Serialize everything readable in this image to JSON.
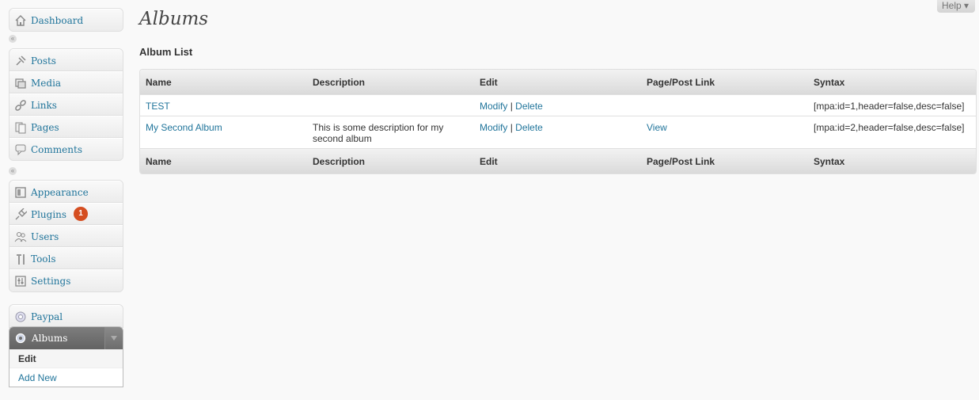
{
  "menu": {
    "group1": [
      {
        "label": "Dashboard",
        "icon": "dashboard-icon"
      }
    ],
    "group2": [
      {
        "label": "Posts",
        "icon": "posts-pin-icon"
      },
      {
        "label": "Media",
        "icon": "media-icon"
      },
      {
        "label": "Links",
        "icon": "links-icon"
      },
      {
        "label": "Pages",
        "icon": "pages-icon"
      },
      {
        "label": "Comments",
        "icon": "comments-icon"
      }
    ],
    "group3": [
      {
        "label": "Appearance",
        "icon": "appearance-icon"
      },
      {
        "label": "Plugins",
        "icon": "plugins-icon",
        "badge": "1"
      },
      {
        "label": "Users",
        "icon": "users-icon"
      },
      {
        "label": "Tools",
        "icon": "tools-icon"
      },
      {
        "label": "Settings",
        "icon": "settings-icon"
      }
    ],
    "group4": [
      {
        "label": "Paypal",
        "icon": "paypal-icon"
      }
    ],
    "albums": {
      "label": "Albums",
      "icon": "albums-gear-icon",
      "submenu": [
        {
          "label": "Edit",
          "current": true
        },
        {
          "label": "Add New",
          "current": false
        }
      ]
    },
    "collapse_symbol": "«"
  },
  "help": {
    "label": "Help ▾"
  },
  "page": {
    "title": "Albums",
    "subtitle": "Album List"
  },
  "table": {
    "columns": [
      "Name",
      "Description",
      "Edit",
      "Page/Post Link",
      "Syntax"
    ],
    "rows": [
      {
        "name": "TEST",
        "description": "",
        "modify": "Modify",
        "sep": "|",
        "delete": "Delete",
        "link": "",
        "syntax": "[mpa:id=1,header=false,desc=false]"
      },
      {
        "name": "My Second Album",
        "description": "This is some description for my second album",
        "modify": "Modify",
        "sep": "|",
        "delete": "Delete",
        "link": "View",
        "syntax": "[mpa:id=2,header=false,desc=false]"
      }
    ]
  },
  "colors": {
    "link": "#21759b",
    "badge": "#d54e21",
    "active_menu": "#6d6d6d"
  }
}
